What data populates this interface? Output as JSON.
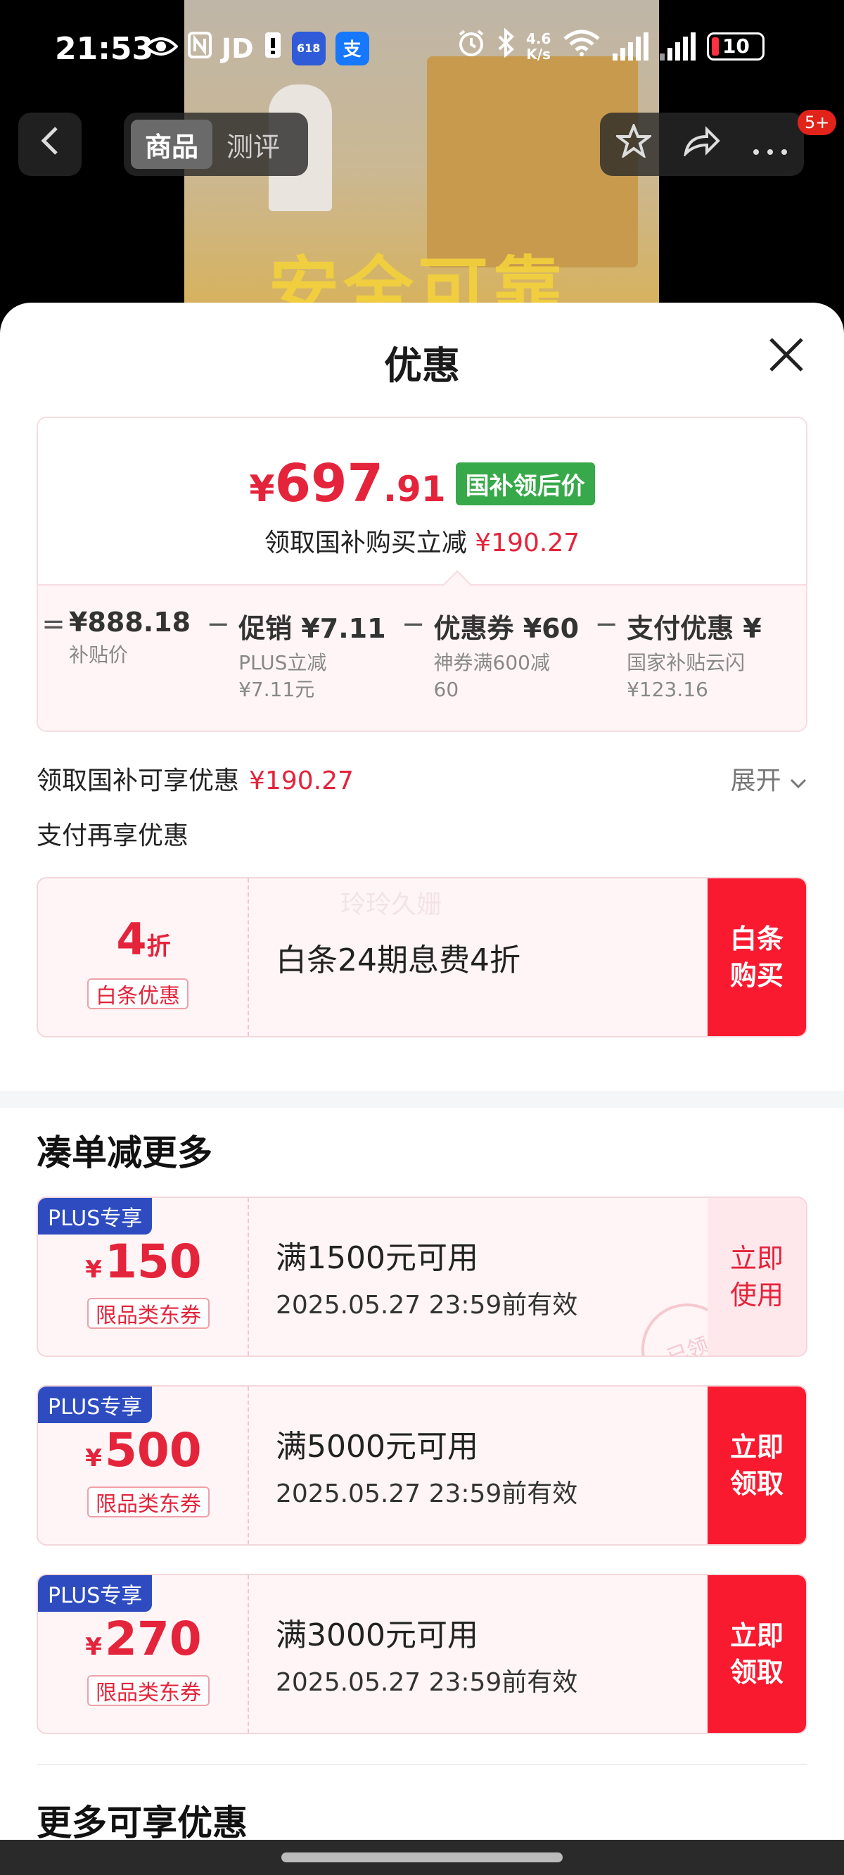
{
  "status_bar": {
    "time": "21:53",
    "left_icons": [
      "eye-icon",
      "nfc-icon",
      "jd-icon",
      "sim-icon",
      "app-618-icon",
      "alipay-icon"
    ],
    "jd_text": "JD",
    "alipay_text": "支",
    "app_text": "618",
    "net_speed": "4.6",
    "net_unit": "K/s",
    "battery": "10"
  },
  "nav": {
    "tabs": [
      "商品",
      "测评"
    ],
    "active_tab": "商品",
    "badge": "5+"
  },
  "background": {
    "overlay_text": "安全可靠"
  },
  "sheet": {
    "title": "优惠",
    "price": {
      "yen": "¥",
      "integer": "697",
      "decimal": ".91",
      "tag": "国补领后价",
      "sub_label": "领取国补购买立减",
      "sub_amount": "¥190.27"
    },
    "formula": [
      {
        "op": "=",
        "value": "¥888.18",
        "label": "补贴价"
      },
      {
        "op": "−",
        "value": "促销 ¥7.11",
        "label": "PLUS立减\n¥7.11元"
      },
      {
        "op": "−",
        "value": "优惠券 ¥60",
        "label": "神券满600减\n60"
      },
      {
        "op": "−",
        "value": "支付优惠 ¥",
        "label": "国家补贴云闪\n¥123.16"
      }
    ],
    "national_line": {
      "label": "领取国补可享优惠",
      "amount": "¥190.27",
      "expand": "展开"
    },
    "pay_title": "支付再享优惠",
    "pay_coupon": {
      "value": "4",
      "unit": "折",
      "tag": "白条优惠",
      "watermark": "玲玲久姗",
      "main": "白条24期息费4折",
      "action": "白条\n购买"
    },
    "bundle_title": "凑单减更多",
    "coupons": [
      {
        "badge": "PLUS专享",
        "yen": "¥",
        "value": "150",
        "tag": "限品类东券",
        "main": "满1500元可用",
        "date": "2025.05.27 23:59前有效",
        "action": "立即\n使用",
        "claimed": true,
        "stamp": "已领"
      },
      {
        "badge": "PLUS专享",
        "yen": "¥",
        "value": "500",
        "tag": "限品类东券",
        "main": "满5000元可用",
        "date": "2025.05.27 23:59前有效",
        "action": "立即\n领取",
        "claimed": false
      },
      {
        "badge": "PLUS专享",
        "yen": "¥",
        "value": "270",
        "tag": "限品类东券",
        "main": "满3000元可用",
        "date": "2025.05.27 23:59前有效",
        "action": "立即\n领取",
        "claimed": false
      }
    ],
    "more_title": "更多可享优惠"
  },
  "colors": {
    "accent_red": "#e4243b",
    "button_red": "#fa1a30",
    "plus_blue": "#2e4cc0",
    "tag_green": "#37a94a"
  }
}
